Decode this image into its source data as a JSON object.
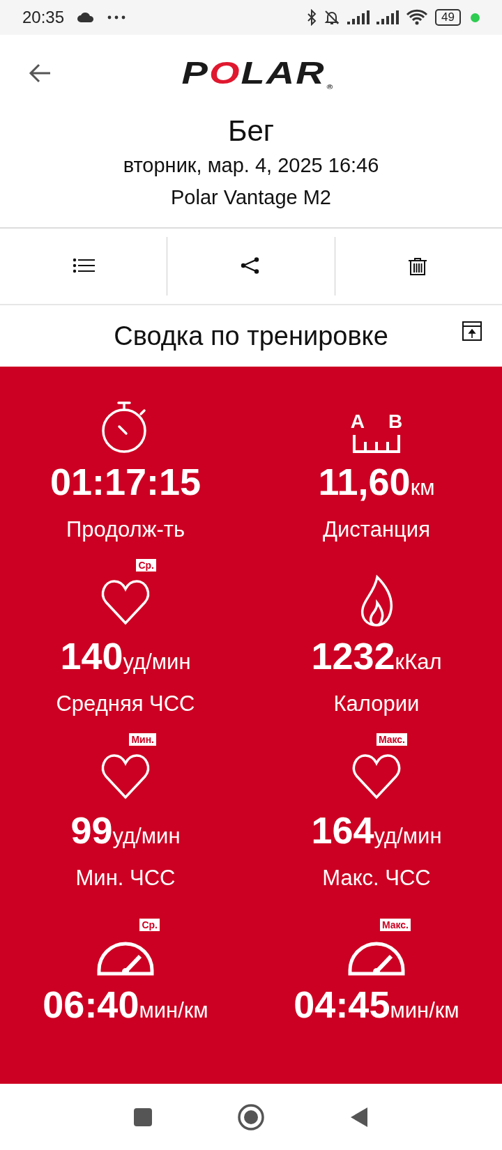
{
  "status_bar": {
    "time": "20:35",
    "battery": "49"
  },
  "header": {
    "logo": "POLAR",
    "logo_mark": "®",
    "title": "Бег",
    "date": "вторник, мар. 4, 2025 16:46",
    "device": "Polar Vantage M2"
  },
  "toolbar": [
    {
      "kind": "list"
    },
    {
      "kind": "share"
    },
    {
      "kind": "delete"
    }
  ],
  "summary": {
    "title": "Сводка по тренировке",
    "distance_icon_letters": [
      "A",
      "B"
    ],
    "items": [
      {
        "kind": "stopwatch",
        "value": "01:17:15",
        "label": "Продолж-ть"
      },
      {
        "kind": "distance",
        "value": "11,60",
        "unit": "км",
        "label": "Дистанция"
      },
      {
        "kind": "heart",
        "badge": "Ср.",
        "value": "140",
        "unit": "уд/мин",
        "label": "Средняя ЧСС"
      },
      {
        "kind": "flame",
        "value": "1232",
        "unit": "кКал",
        "label": "Калории"
      },
      {
        "kind": "heart",
        "badge": "Мин.",
        "value": "99",
        "unit": "уд/мин",
        "label": "Мин. ЧСС"
      },
      {
        "kind": "heart",
        "badge": "Макс.",
        "value": "164",
        "unit": "уд/мин",
        "label": "Макс. ЧСС"
      },
      {
        "kind": "gauge",
        "badge": "Ср.",
        "value": "06:40",
        "unit": "мин/км"
      },
      {
        "kind": "gauge",
        "badge": "Макс.",
        "value": "04:45",
        "unit": "мин/км"
      }
    ]
  }
}
